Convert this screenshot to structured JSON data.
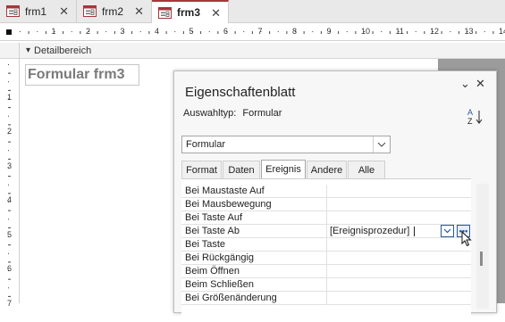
{
  "tabs": [
    {
      "label": "frm1",
      "active": false
    },
    {
      "label": "frm2",
      "active": false
    },
    {
      "label": "frm3",
      "active": true
    }
  ],
  "section": {
    "label": "Detailbereich"
  },
  "form_label": "Formular frm3",
  "ruler": {
    "h_labels": [
      "1",
      "2",
      "3",
      "4",
      "5",
      "6",
      "7",
      "8",
      "9",
      "10",
      "11",
      "12",
      "13",
      "14"
    ],
    "v_labels": [
      "1",
      "2",
      "3",
      "4",
      "5",
      "6",
      "7"
    ]
  },
  "property_sheet": {
    "title": "Eigenschaftenblatt",
    "selection_type_label": "Auswahltyp:",
    "selection_type_value": "Formular",
    "object_combo": "Formular",
    "tabs": [
      "Format",
      "Daten",
      "Ereignis",
      "Andere",
      "Alle"
    ],
    "active_tab": "Ereignis",
    "rows": [
      {
        "name": "Bei Maustaste Auf",
        "value": ""
      },
      {
        "name": "Bei Mausbewegung",
        "value": ""
      },
      {
        "name": "Bei Taste Auf",
        "value": ""
      },
      {
        "name": "Bei Taste Ab",
        "value": "[Ereignisprozedur]"
      },
      {
        "name": "Bei Taste",
        "value": ""
      },
      {
        "name": "Bei Rückgängig",
        "value": ""
      },
      {
        "name": "Beim Öffnen",
        "value": ""
      },
      {
        "name": "Beim Schließen",
        "value": ""
      },
      {
        "name": "Bei Größenänderung",
        "value": ""
      }
    ]
  },
  "colors": {
    "accent": "#a4373a",
    "link": "#2b579a"
  }
}
